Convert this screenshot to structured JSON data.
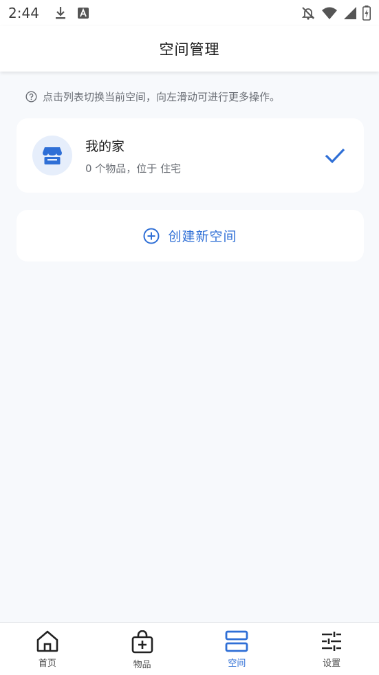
{
  "status_bar": {
    "time": "2:44",
    "icons": [
      "download-icon",
      "text-a-icon",
      "notifications-off-icon",
      "wifi-icon",
      "signal-icon",
      "battery-charging-icon"
    ]
  },
  "app_bar": {
    "title": "空间管理"
  },
  "hint": {
    "icon": "help-circle-icon",
    "text": "点击列表切换当前空间，向左滑动可进行更多操作。"
  },
  "spaces": [
    {
      "name": "我的家",
      "description": "0 个物品，位于 住宅",
      "icon": "store-icon",
      "selected": true
    }
  ],
  "create_space": {
    "label": "创建新空间",
    "icon": "add-circle-icon"
  },
  "bottom_nav": {
    "items": [
      {
        "label": "首页",
        "icon": "home-icon",
        "active": false
      },
      {
        "label": "物品",
        "icon": "bag-plus-icon",
        "active": false
      },
      {
        "label": "空间",
        "icon": "space-icon",
        "active": true
      },
      {
        "label": "设置",
        "icon": "sliders-icon",
        "active": false
      }
    ]
  },
  "colors": {
    "accent": "#2f6fd6",
    "background": "#f7f9fc",
    "card": "#ffffff",
    "avatar_bg": "#e6eefb"
  }
}
